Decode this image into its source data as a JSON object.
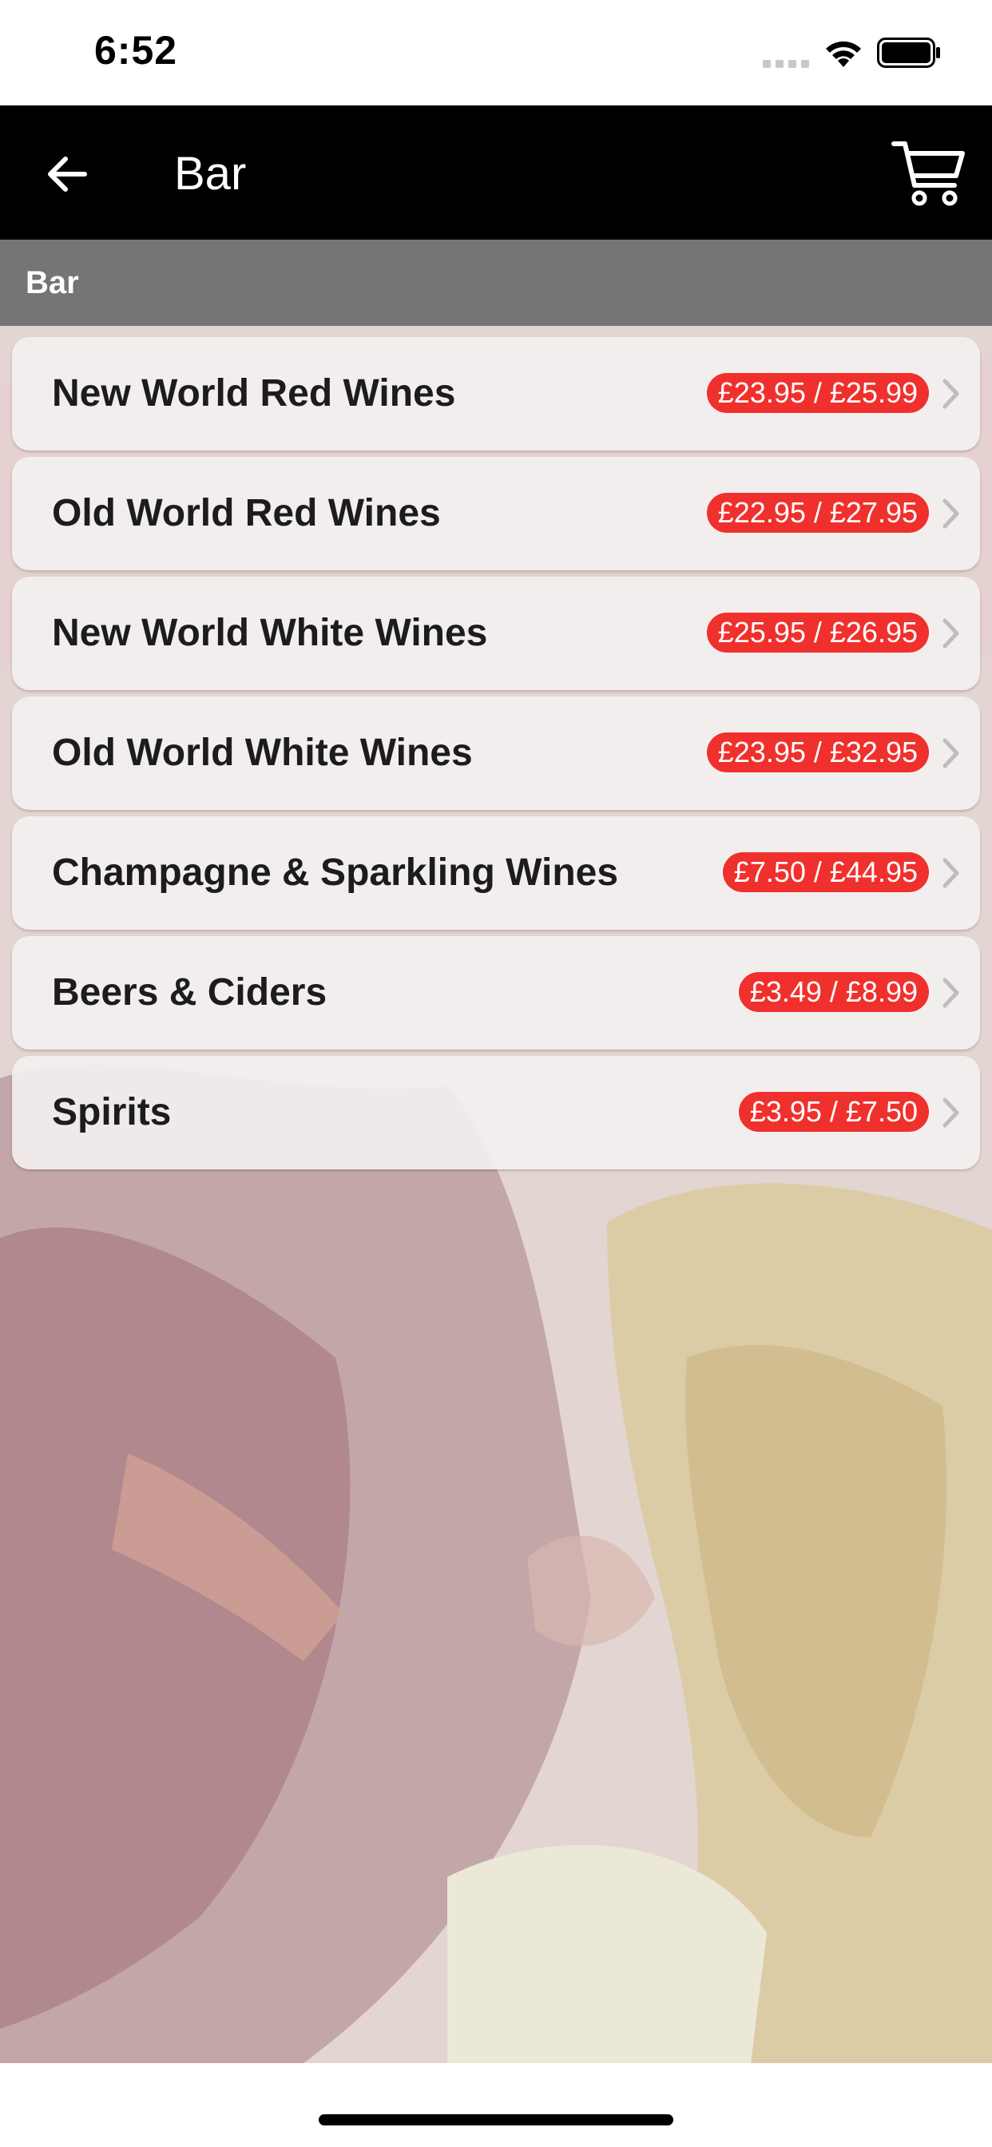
{
  "status_bar": {
    "time": "6:52",
    "icons": [
      "signal-icon",
      "wifi-icon",
      "battery-icon"
    ]
  },
  "nav": {
    "title": "Bar",
    "back_icon": "arrow-left-icon",
    "cart_icon": "shopping-cart-icon",
    "background_color": "#000000"
  },
  "section": {
    "header": "Bar"
  },
  "menu": {
    "items": [
      {
        "title": "New World Red Wines",
        "price": "£23.95 / £25.99"
      },
      {
        "title": "Old World Red Wines",
        "price": "£22.95 / £27.95"
      },
      {
        "title": "New World White Wines",
        "price": "£25.95 / £26.95"
      },
      {
        "title": "Old World White Wines",
        "price": "£23.95 / £32.95"
      },
      {
        "title": "Champagne & Sparkling Wines",
        "price": "£7.50 / £44.95"
      },
      {
        "title": "Beers & Ciders",
        "price": "£3.49 / £8.99"
      },
      {
        "title": "Spirits",
        "price": "£3.95 / £7.50"
      }
    ],
    "chevron_icon": "chevron-right-icon"
  },
  "colors": {
    "accent": "#f0302c",
    "row_background": "#f4f1f1"
  }
}
